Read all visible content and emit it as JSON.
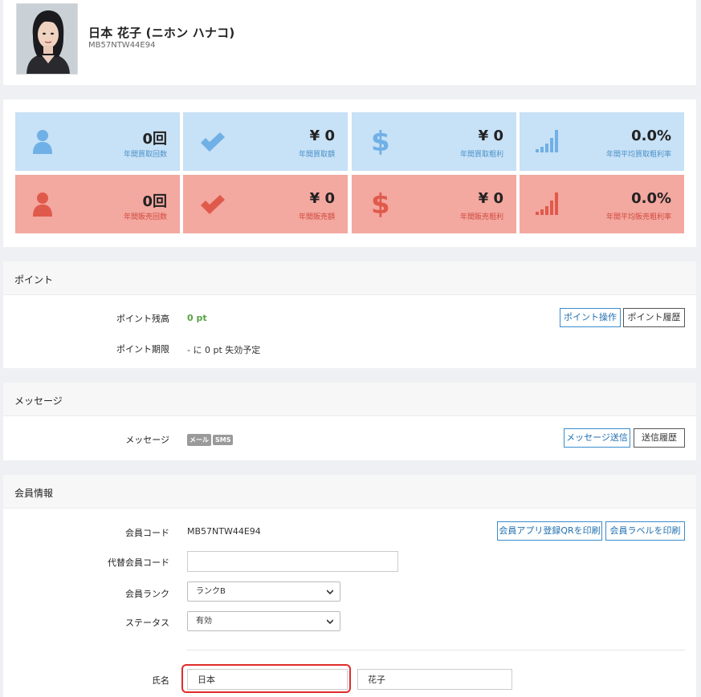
{
  "profile": {
    "name": "日本 花子 (ニホン ハナコ)",
    "code": "MB57NTW44E94"
  },
  "stats": {
    "buy": [
      {
        "icon": "user-icon",
        "value": "0回",
        "label": "年間買取回数"
      },
      {
        "icon": "check-icon",
        "value": "¥ 0",
        "label": "年間買取額"
      },
      {
        "icon": "dollar-icon",
        "value": "¥ 0",
        "label": "年間買取粗利"
      },
      {
        "icon": "signal-bars-icon",
        "value": "0.0%",
        "label": "年間平均買取粗利率"
      }
    ],
    "sell": [
      {
        "icon": "user-icon",
        "value": "0回",
        "label": "年間販売回数"
      },
      {
        "icon": "check-icon",
        "value": "¥ 0",
        "label": "年間販売額"
      },
      {
        "icon": "dollar-icon",
        "value": "¥ 0",
        "label": "年間販売粗利"
      },
      {
        "icon": "signal-bars-icon",
        "value": "0.0%",
        "label": "年間平均販売粗利率"
      }
    ],
    "colors": {
      "buy_bg": "#c7e1f6",
      "buy_icon": "#6fb0e6",
      "sell_bg": "#f3a8a0",
      "sell_icon": "#e05a4c"
    }
  },
  "points": {
    "header": "ポイント",
    "balance_label": "ポイント残高",
    "balance_value": "0 pt",
    "expiry_label": "ポイント期限",
    "expiry_value": "- に 0 pt 失効予定",
    "operate_button": "ポイント操作",
    "history_button": "ポイント履歴"
  },
  "messages": {
    "header": "メッセージ",
    "label": "メッセージ",
    "badges": [
      "メール",
      "SMS"
    ],
    "send_button": "メッセージ送信",
    "history_button": "送信履歴"
  },
  "member": {
    "header": "会員情報",
    "code_label": "会員コード",
    "code_value": "MB57NTW44E94",
    "print_qr_button": "会員アプリ登録QRを印刷",
    "print_label_button": "会員ラベルを印刷",
    "alt_code_label": "代替会員コード",
    "alt_code_value": "",
    "rank_label": "会員ランク",
    "rank_value": "ランクB",
    "status_label": "ステータス",
    "status_value": "有効",
    "name_label": "氏名",
    "last_name_value": "日本",
    "first_name_value": "花子"
  }
}
